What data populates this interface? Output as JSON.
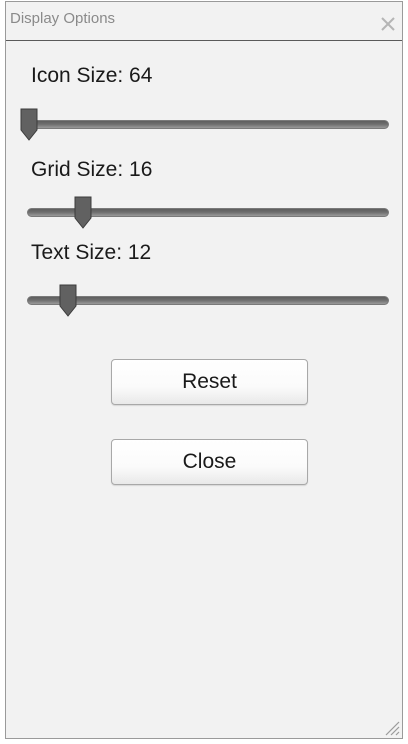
{
  "window": {
    "title": "Display Options",
    "close_icon": "close-icon",
    "resize_icon": "resize-grip-icon"
  },
  "sliders": [
    {
      "label": "Icon Size: 64",
      "fraction": 0.0
    },
    {
      "label": "Grid Size: 16",
      "fraction": 0.15
    },
    {
      "label": "Text Size: 12",
      "fraction": 0.11
    }
  ],
  "buttons": {
    "reset_label": "Reset",
    "close_label": "Close"
  }
}
